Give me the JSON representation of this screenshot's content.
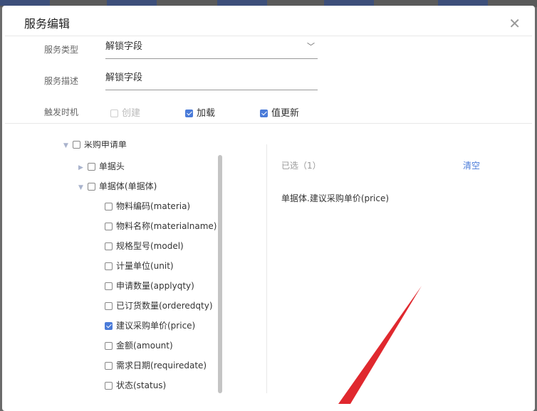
{
  "dialog": {
    "title": "服务编辑"
  },
  "form": {
    "service_type_label": "服务类型",
    "service_type_value": "解锁字段",
    "service_desc_label": "服务描述",
    "service_desc_value": "解锁字段",
    "trigger_label": "触发时机",
    "triggers": [
      {
        "label": "创建",
        "checked": false,
        "disabled": true
      },
      {
        "label": "加载",
        "checked": true
      },
      {
        "label": "值更新",
        "checked": true
      }
    ]
  },
  "tree": {
    "root": "采购申请单",
    "header": "单据头",
    "body": "单据体(单据体)",
    "fields": [
      {
        "label": "物料编码(materia)",
        "checked": false
      },
      {
        "label": "物料名称(materialname)",
        "checked": false
      },
      {
        "label": "规格型号(model)",
        "checked": false
      },
      {
        "label": "计量单位(unit)",
        "checked": false
      },
      {
        "label": "申请数量(applyqty)",
        "checked": false
      },
      {
        "label": "已订货数量(orderedqty)",
        "checked": false
      },
      {
        "label": "建议采购单价(price)",
        "checked": true
      },
      {
        "label": "金额(amount)",
        "checked": false
      },
      {
        "label": "需求日期(requiredate)",
        "checked": false
      },
      {
        "label": "状态(status)",
        "checked": false
      }
    ]
  },
  "selected": {
    "label": "已选（1）",
    "clear": "清空",
    "items": [
      "单据体.建议采购单价(price)"
    ]
  },
  "colors": {
    "accent": "#4a7bd9",
    "arrow": "#e0282e"
  }
}
